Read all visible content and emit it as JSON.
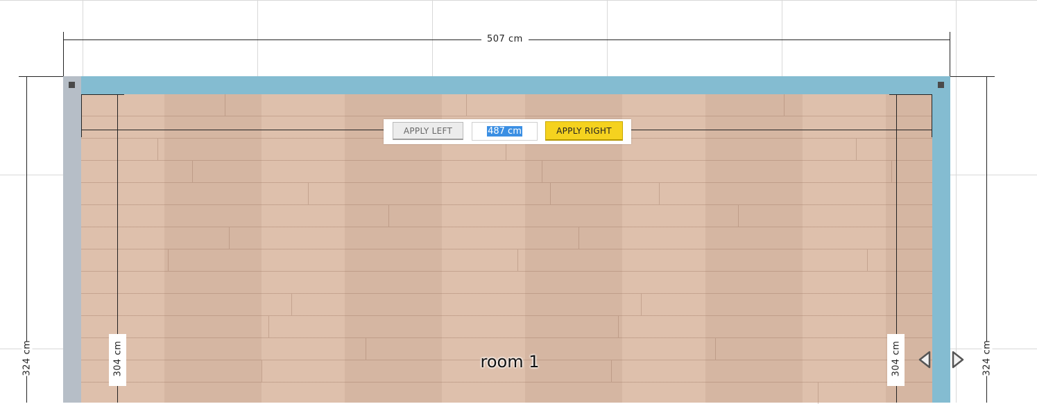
{
  "dimensions": {
    "top_total": "507 cm",
    "left_outer": "324 cm",
    "left_inner": "304 cm",
    "right_inner": "304 cm",
    "right_outer": "324 cm"
  },
  "toolbar": {
    "apply_left_label": "APPLY LEFT",
    "length_value": "487 cm",
    "apply_right_label": "APPLY RIGHT"
  },
  "room": {
    "name": "room 1"
  },
  "colors": {
    "wall_blue": "#84bcd1",
    "wall_grey": "#b6bec7",
    "floor": "#dcbca7",
    "apply_right_bg": "#f5d21f",
    "selection": "#3b8fe3"
  },
  "icons": {
    "prev": "triangle-left-outline",
    "next": "triangle-right-outline"
  }
}
